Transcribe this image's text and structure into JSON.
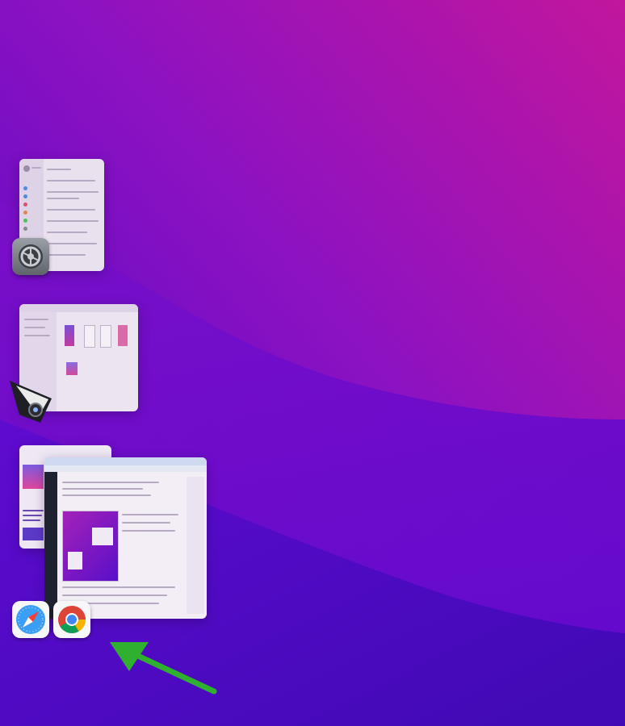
{
  "desktop": {
    "wallpaper_colors": [
      "#c2169d",
      "#8c12c2",
      "#5a06cc",
      "#3f08b8"
    ]
  },
  "groups": [
    {
      "id": "system-settings",
      "app_icon": "system-settings-icon",
      "windows": [
        {
          "kind": "settings-window"
        }
      ]
    },
    {
      "id": "preview",
      "app_icon": "preview-icon",
      "windows": [
        {
          "kind": "finder-window"
        }
      ]
    },
    {
      "id": "browsers",
      "app_icons": [
        "safari-icon",
        "chrome-icon"
      ],
      "windows": [
        {
          "kind": "browser-window-back"
        },
        {
          "kind": "browser-window-front"
        }
      ]
    }
  ],
  "annotation": {
    "arrow_color": "#2fb12f",
    "points_to": "chrome-icon"
  }
}
